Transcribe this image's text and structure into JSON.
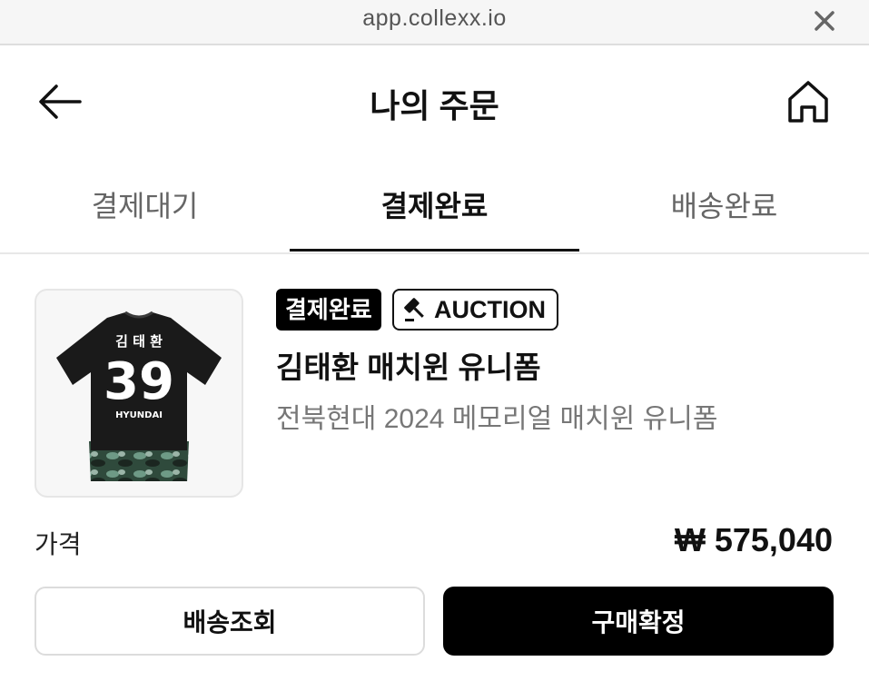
{
  "browser": {
    "url": "app.collexx.io",
    "close_icon": "close-icon"
  },
  "header": {
    "title": "나의 주문",
    "back_icon": "arrow-left-icon",
    "home_icon": "home-icon"
  },
  "tabs": [
    {
      "label": "결제대기",
      "active": false
    },
    {
      "label": "결제완료",
      "active": true
    },
    {
      "label": "배송완료",
      "active": false
    }
  ],
  "order": {
    "status_badge": "결제완료",
    "type_badge": {
      "icon": "gavel-icon",
      "label": "AUCTION"
    },
    "product_name": "김태환 매치윈 유니폼",
    "product_desc": "전북현대 2024 메모리얼 매치윈 유니폼",
    "jersey": {
      "name": "김 태 환",
      "number": "39",
      "sponsor": "HYUNDAI"
    },
    "price_label": "가격",
    "price_value": "₩ 575,040"
  },
  "actions": {
    "track_label": "배송조회",
    "confirm_label": "구매확정"
  },
  "colors": {
    "primary": "#000000",
    "muted_text": "#777777",
    "border": "#dcdcdc"
  }
}
